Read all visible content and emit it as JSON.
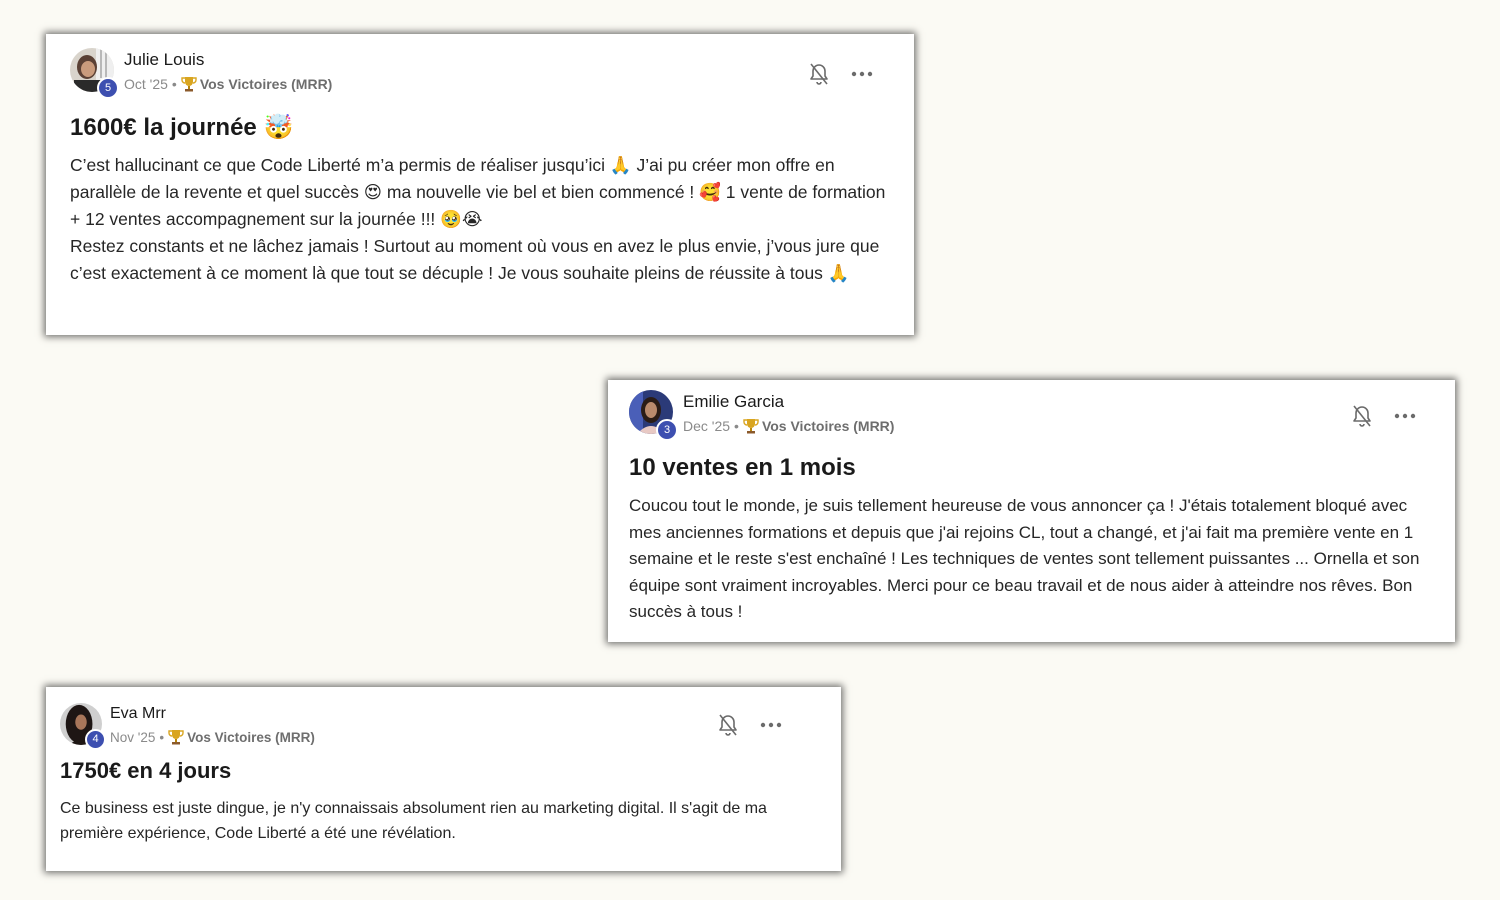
{
  "posts": [
    {
      "author": "Julie Louis",
      "level": "5",
      "date": "Oct '25",
      "separator": "•",
      "category": "Vos Victoires (MRR)",
      "title": "1600€ la journée 🤯",
      "body": "C’est hallucinant ce que Code Liberté m’a permis de réaliser jusqu’ici 🙏 J’ai pu créer mon offre en parallèle de la revente et quel succès 😍 ma nouvelle vie bel et bien commencé ! 🥰 1 vente de formation + 12 ventes accompagnement sur la journée !!! 🥹😭\nRestez constants et ne lâchez jamais ! Surtout au moment où vous en avez le plus envie, j’vous jure que c’est exactement à ce moment là que tout se décuple ! Je vous souhaite pleins de réussite à tous 🙏"
    },
    {
      "author": "Emilie Garcia",
      "level": "3",
      "date": "Dec '25",
      "separator": "•",
      "category": "Vos Victoires (MRR)",
      "title": "10 ventes en 1 mois",
      "body": "Coucou tout le monde, je suis tellement heureuse de vous annoncer ça ! J'étais totalement bloqué avec mes anciennes formations et depuis que j'ai rejoins CL, tout a changé, et j'ai fait ma première vente en 1 semaine et le reste s'est enchaîné ! Les techniques de ventes sont tellement puissantes ... Ornella et son équipe sont vraiment incroyables. Merci pour ce beau travail et de nous aider à atteindre nos rêves. Bon succès à tous !"
    },
    {
      "author": "Eva Mrr",
      "level": "4",
      "date": "Nov '25",
      "separator": "•",
      "category": "Vos Victoires (MRR)",
      "title": "1750€ en 4 jours",
      "body": "Ce business est juste dingue, je n'y connaissais absolument rien au marketing digital. Il s'agit de ma première expérience, Code Liberté a été une révélation."
    }
  ],
  "icons": {
    "bell": "bell-off-icon",
    "more": "more-horizontal-icon",
    "trophy": "trophy-icon"
  },
  "colors": {
    "background": "#fbfaf4",
    "level_badge": "#3d4fb0",
    "meta_text": "#8a8a8a"
  }
}
